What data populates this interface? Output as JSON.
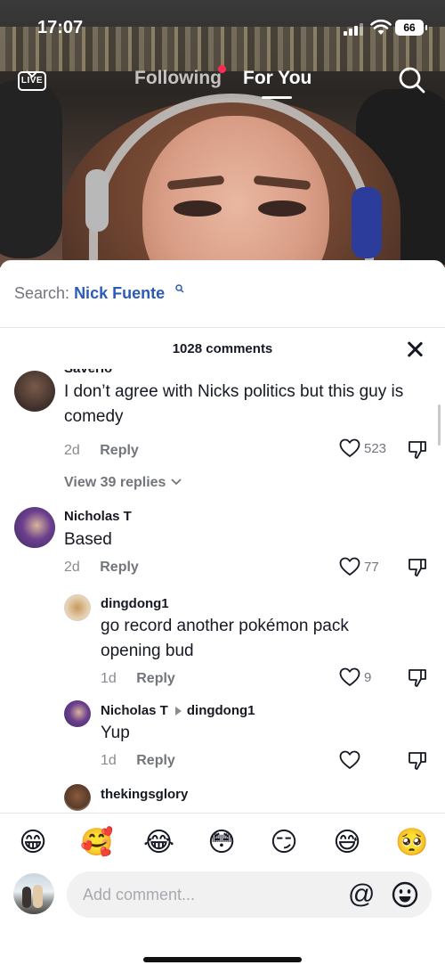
{
  "status_bar": {
    "time": "17:07",
    "battery": "66"
  },
  "top_nav": {
    "live_label": "LIVE",
    "tabs": [
      {
        "label": "Following",
        "has_notification_dot": true,
        "active": false
      },
      {
        "label": "For You",
        "active": true
      }
    ]
  },
  "search_banner": {
    "prefix": "Search:",
    "term": "Nick Fuente"
  },
  "comments_header": {
    "count_label": "1028 comments"
  },
  "comments": [
    {
      "author": "Saverio",
      "text": "I don’t agree with Nicks politics but this guy is comedy",
      "age": "2d",
      "reply_label": "Reply",
      "likes": "523",
      "view_replies": "View 39 replies",
      "avatar_color": "#3d2f2a"
    },
    {
      "author": "Nicholas T",
      "text": "Based",
      "age": "2d",
      "reply_label": "Reply",
      "likes": "77",
      "avatar_color": "#4b2f6e",
      "replies": [
        {
          "author": "dingdong1",
          "text": "go record another pokémon pack opening bud",
          "age": "1d",
          "reply_label": "Reply",
          "likes": "9",
          "avatar_color": "#d8c2a6"
        },
        {
          "author": "Nicholas T",
          "reply_to": "dingdong1",
          "text": "Yup",
          "age": "1d",
          "reply_label": "Reply",
          "likes": "",
          "avatar_color": "#4b2f6e"
        }
      ]
    },
    {
      "author": "thekingsglory",
      "avatar_color": "#5a3b2a"
    }
  ],
  "emoji_bar": [
    "😁",
    "🥰",
    "😂",
    "😳",
    "😏",
    "😅",
    "🥺"
  ],
  "comment_input": {
    "placeholder": "Add comment...",
    "mention_label": "@"
  },
  "colors": {
    "link_blue": "#2b5bb8",
    "notification_red": "#fe2c55",
    "muted_text": "#8a8b91"
  }
}
